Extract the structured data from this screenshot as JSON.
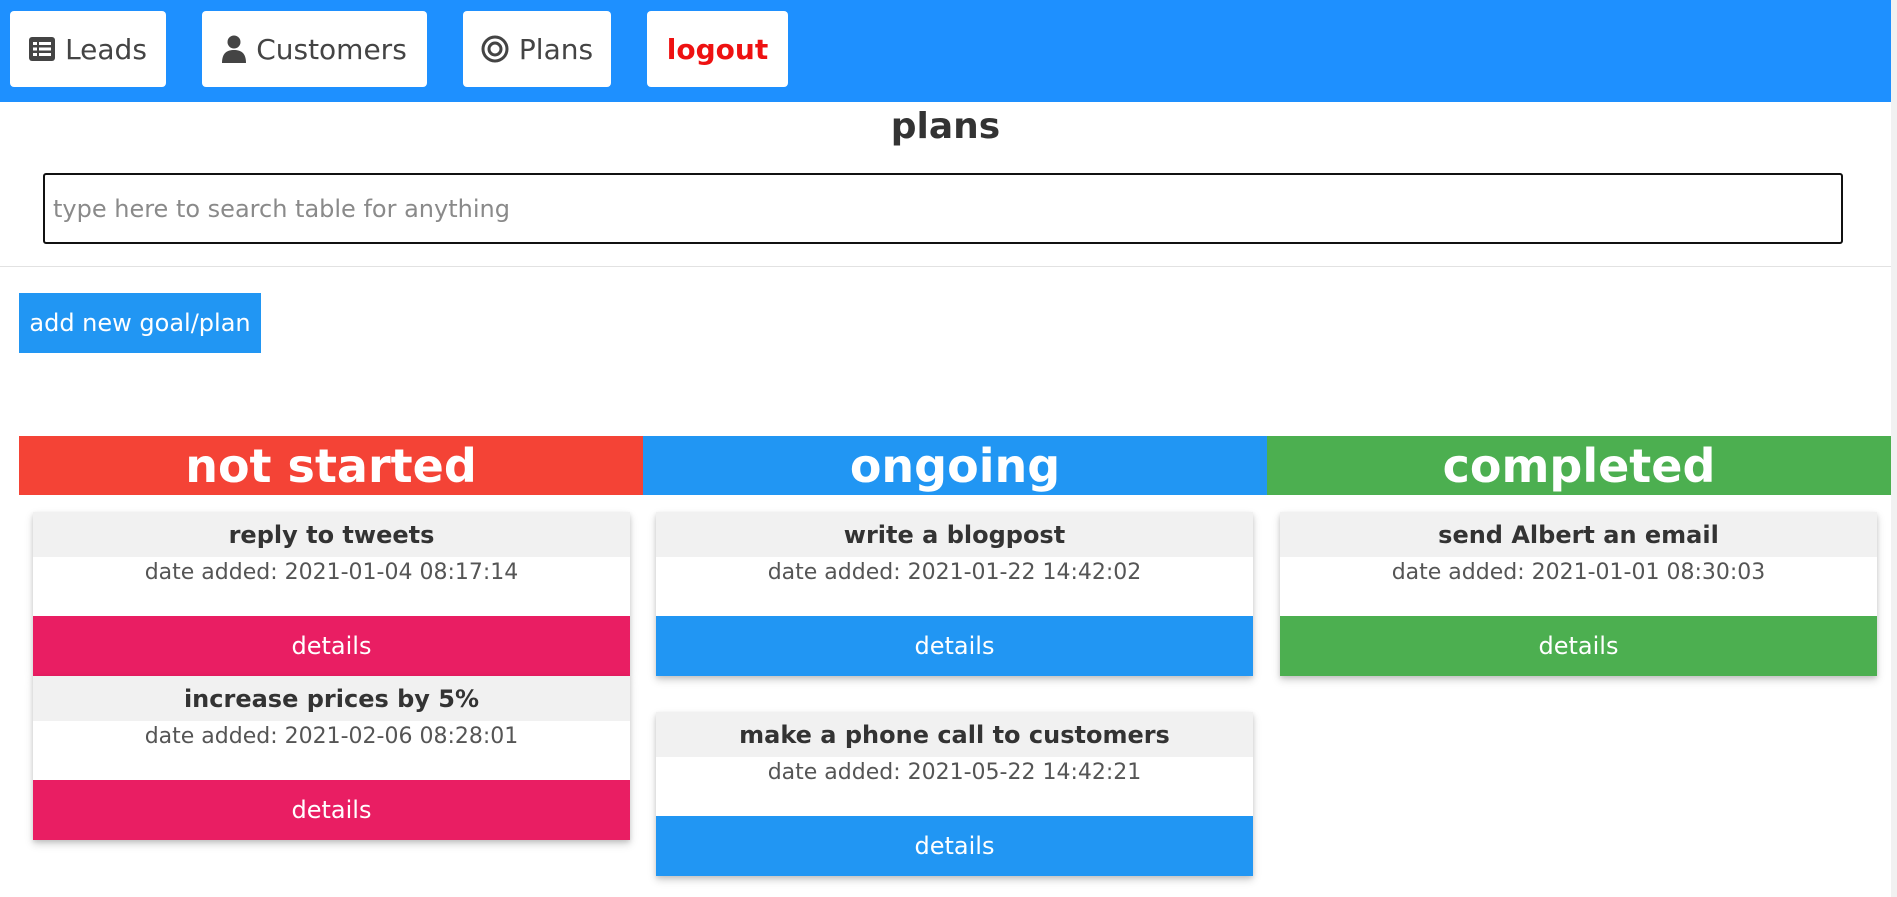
{
  "nav": {
    "leads": {
      "label": "Leads",
      "icon": "list-icon"
    },
    "customers": {
      "label": "Customers",
      "icon": "user-icon"
    },
    "plans": {
      "label": "Plans",
      "icon": "target-icon"
    },
    "logout": {
      "label": "logout"
    }
  },
  "page": {
    "title": "plans",
    "search_placeholder": "type here to search table for anything",
    "add_button": "add new goal/plan"
  },
  "colors": {
    "topbar": "#1e90ff",
    "not_started": "#f44336",
    "ongoing": "#2196f3",
    "completed": "#4caf50",
    "not_started_button": "#e91e63",
    "logout_text": "#ee1111"
  },
  "columns": [
    {
      "title": "not started",
      "cards": [
        {
          "title": "reply to tweets",
          "date": "date added: 2021-01-04 08:17:14",
          "button": "details"
        },
        {
          "title": "increase prices by 5%",
          "date": "date added: 2021-02-06 08:28:01",
          "button": "details"
        }
      ]
    },
    {
      "title": "ongoing",
      "cards": [
        {
          "title": "write a blogpost",
          "date": "date added: 2021-01-22 14:42:02",
          "button": "details"
        },
        {
          "title": "make a phone call to customers",
          "date": "date added: 2021-05-22 14:42:21",
          "button": "details"
        }
      ]
    },
    {
      "title": "completed",
      "cards": [
        {
          "title": "send Albert an email",
          "date": "date added: 2021-01-01 08:30:03",
          "button": "details"
        }
      ]
    }
  ]
}
